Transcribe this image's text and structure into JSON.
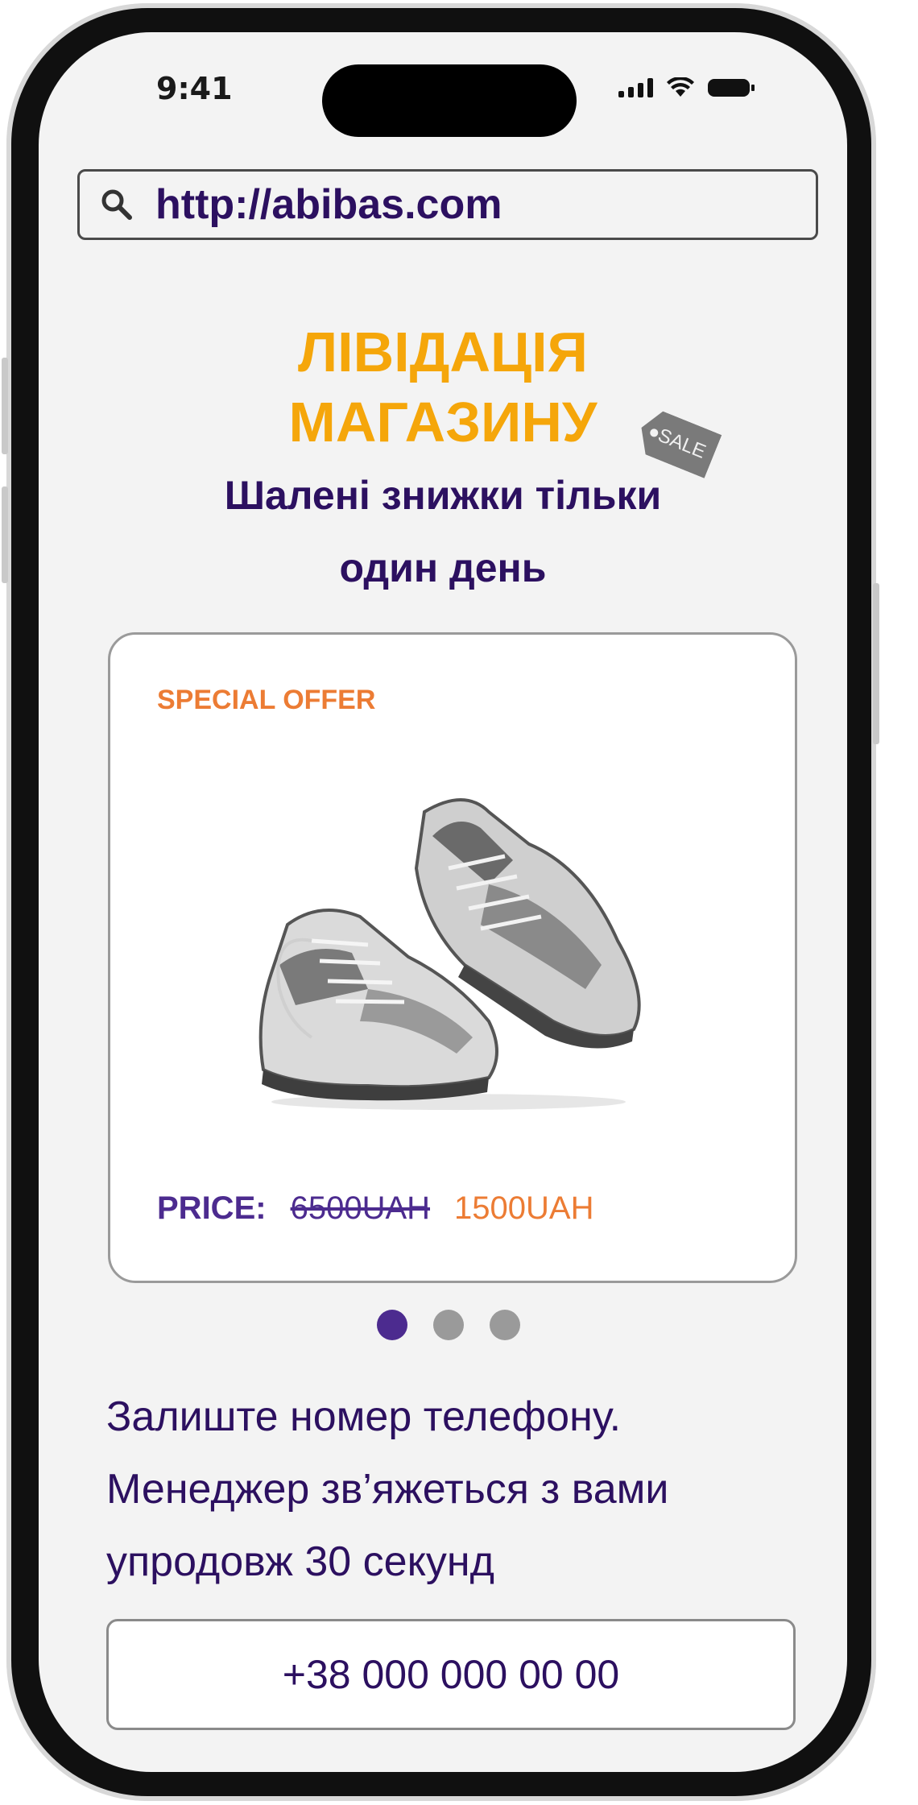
{
  "status_bar": {
    "time": "9:41"
  },
  "browser": {
    "url": "http://abibas.com",
    "search_icon": "search-icon"
  },
  "hero": {
    "title_line1": "ЛІВІДАЦІЯ",
    "title_line2": "МАГАЗИНУ",
    "sale_tag": "SALE",
    "subtitle_line1": "Шалені знижки тільки",
    "subtitle_line2": "один день"
  },
  "offer_card": {
    "label": "SPECIAL OFFER",
    "price_label": "PRICE:",
    "old_price": "6500UAH",
    "new_price": "1500UAH",
    "image": "sneakers-photo"
  },
  "carousel": {
    "total_slides": 3,
    "active_slide": 1
  },
  "callback": {
    "line1": "Залиште номер телефону.",
    "line2": "Менеджер зв’яжеться з вами",
    "line3": "упродовж 30 секунд",
    "phone_placeholder": "+38 000 000 00 00"
  },
  "colors": {
    "accent_orange": "#ec7c34",
    "headline_yellow": "#f5a60a",
    "dark_purple": "#2c1060",
    "purple": "#4c2b8f"
  }
}
